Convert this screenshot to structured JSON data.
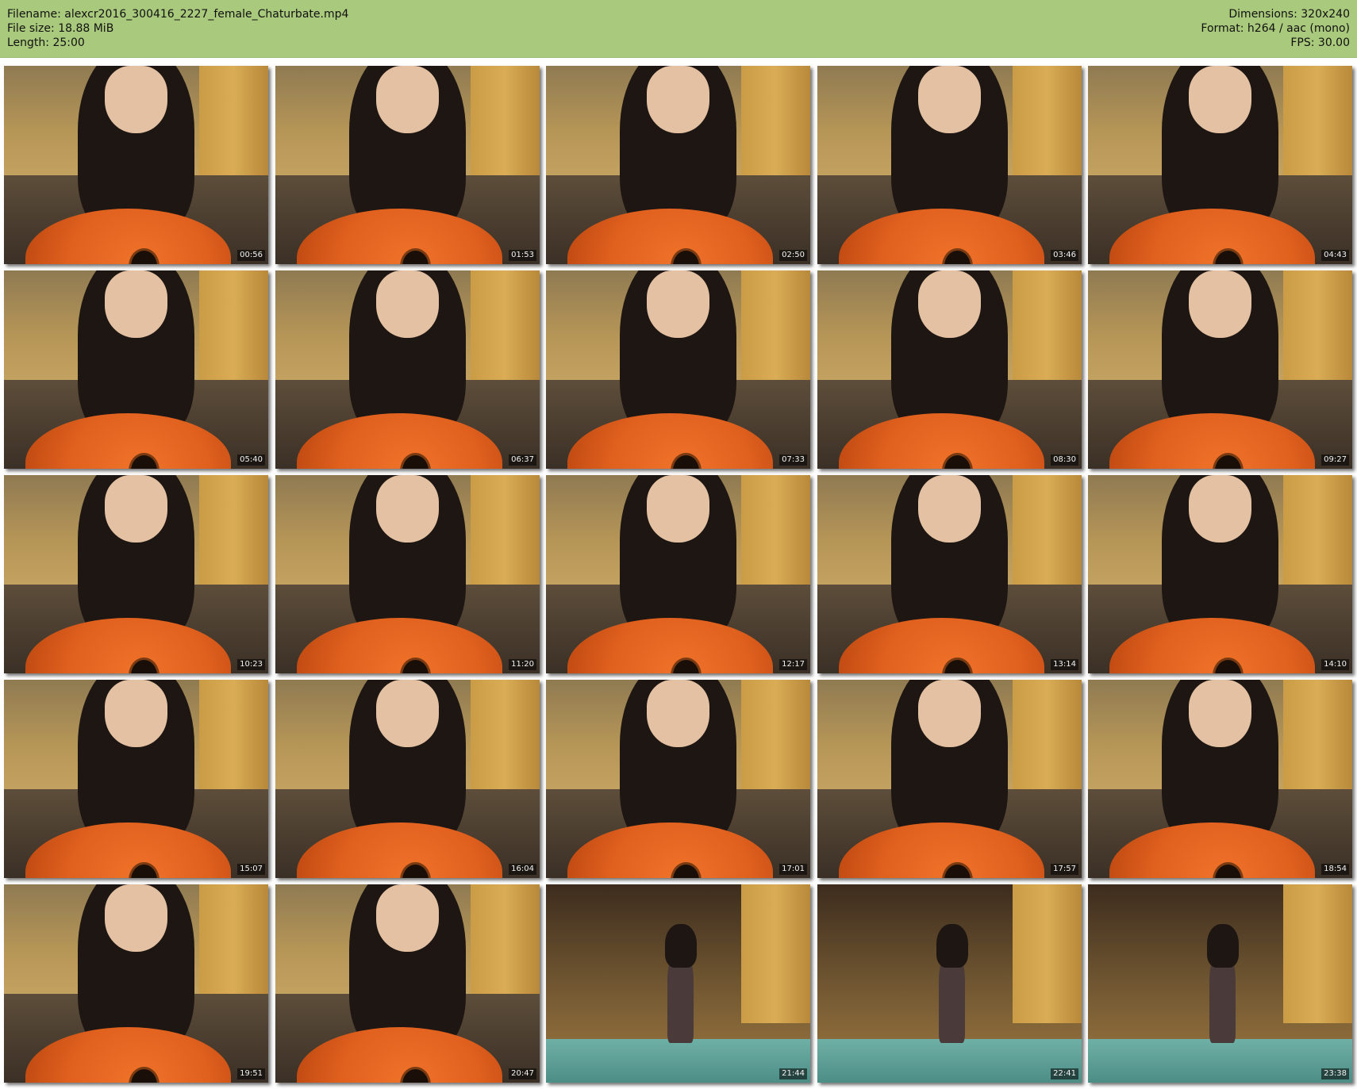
{
  "header": {
    "filename_label": "Filename: alexcr2016_300416_2227_female_Chaturbate.mp4",
    "filesize_label": "File size: 18.88 MiB",
    "length_label": "Length: 25:00",
    "dimensions_label": "Dimensions: 320x240",
    "format_label": "Format: h264 / aac (mono)",
    "fps_label": "FPS: 30.00"
  },
  "thumbnails": [
    {
      "time": "00:56"
    },
    {
      "time": "01:53"
    },
    {
      "time": "02:50"
    },
    {
      "time": "03:46"
    },
    {
      "time": "04:43"
    },
    {
      "time": "05:40"
    },
    {
      "time": "06:37"
    },
    {
      "time": "07:33"
    },
    {
      "time": "08:30"
    },
    {
      "time": "09:27"
    },
    {
      "time": "10:23"
    },
    {
      "time": "11:20"
    },
    {
      "time": "12:17"
    },
    {
      "time": "13:14"
    },
    {
      "time": "14:10"
    },
    {
      "time": "15:07"
    },
    {
      "time": "16:04"
    },
    {
      "time": "17:01"
    },
    {
      "time": "17:57"
    },
    {
      "time": "18:54"
    },
    {
      "time": "19:51"
    },
    {
      "time": "20:47"
    },
    {
      "time": "21:44"
    },
    {
      "time": "22:41"
    },
    {
      "time": "23:38"
    }
  ]
}
